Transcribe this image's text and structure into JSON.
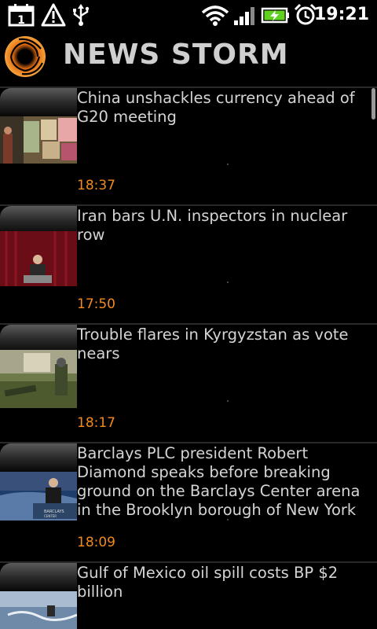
{
  "status_bar": {
    "time": "19:21",
    "calendar_day": "1",
    "icons": [
      "calendar-icon",
      "warning-icon",
      "usb-icon",
      "wifi-icon",
      "signal-icon",
      "battery-charging-icon",
      "alarm-clock-icon"
    ]
  },
  "app": {
    "title": "NEWS STORM",
    "accent_color": "#f08a1c"
  },
  "news_items": [
    {
      "headline": "China unshackles currency ahead of G20 meeting",
      "time": "18:37"
    },
    {
      "headline": "Iran bars U.N. inspectors in nuclear row",
      "time": "17:50"
    },
    {
      "headline": "Trouble flares in Kyrgyzstan as vote nears",
      "time": "18:17"
    },
    {
      "headline": "Barclays PLC president Robert Diamond speaks before breaking ground on the Barclays Center arena in the Brooklyn borough of New York",
      "time": "18:09"
    },
    {
      "headline": "Gulf of Mexico oil spill costs BP $2 billion",
      "time": ""
    }
  ]
}
